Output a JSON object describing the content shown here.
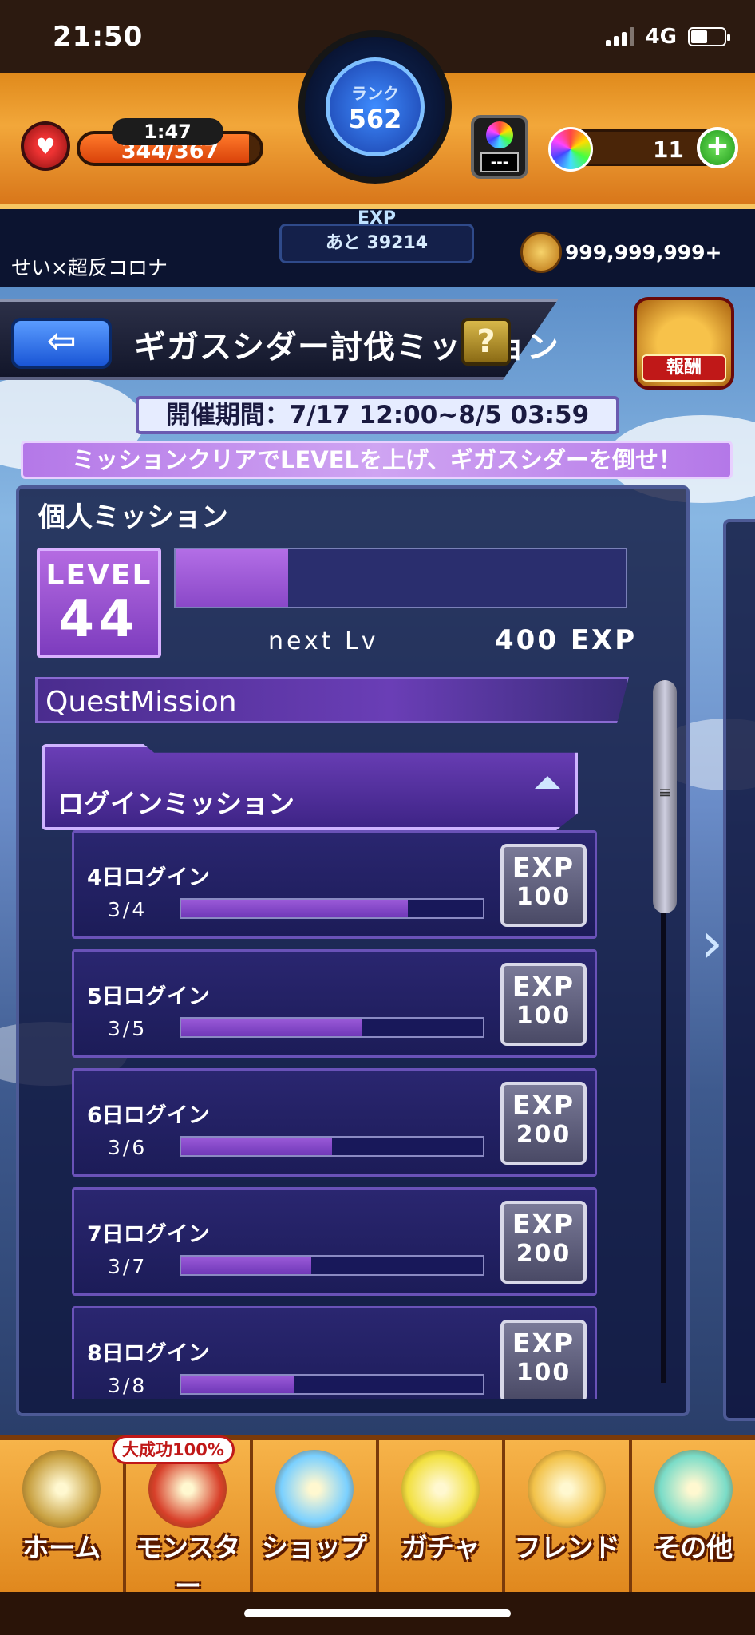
{
  "status_bar": {
    "time": "21:50",
    "network": "4G",
    "battery_icon": "battery-icon",
    "signal_icon": "signal-icon"
  },
  "hud": {
    "stamina_timer": "1:47",
    "stamina": "344/367",
    "stamina_fraction": 0.937,
    "rank_label": "ランク",
    "rank": "562",
    "exp_label": "EXP",
    "exp_remaining": "あと 39214",
    "orb_slot": "---",
    "orb_count": "11",
    "plus_label": "+",
    "username": "せい×超反コロナ",
    "coins": "999,999,999+"
  },
  "title_bar": {
    "back_label": "⇦",
    "title": "ギガスシダー討伐ミッション",
    "help_label": "?",
    "reward_label": "報酬"
  },
  "event": {
    "period": "開催期間：7/17 12:00~8/5 03:59",
    "banner": "ミッションクリアでLEVELを上げ、ギガスシダーを倒せ！"
  },
  "personal": {
    "section_title": "個人ミッション",
    "level_label": "LEVEL",
    "level": "44",
    "level_progress": 0.25,
    "next_label": "next Lv",
    "next_exp": "400",
    "next_exp_unit": "EXP"
  },
  "quest": {
    "header": "QuestMission",
    "group_label": "ログインミッション",
    "missions": [
      {
        "name": "4日ログイン",
        "progress": "3/4",
        "fraction": 0.75,
        "reward_label": "EXP",
        "reward": "100"
      },
      {
        "name": "5日ログイン",
        "progress": "3/5",
        "fraction": 0.6,
        "reward_label": "EXP",
        "reward": "100"
      },
      {
        "name": "6日ログイン",
        "progress": "3/6",
        "fraction": 0.5,
        "reward_label": "EXP",
        "reward": "200"
      },
      {
        "name": "7日ログイン",
        "progress": "3/7",
        "fraction": 0.43,
        "reward_label": "EXP",
        "reward": "200"
      },
      {
        "name": "8日ログイン",
        "progress": "3/8",
        "fraction": 0.375,
        "reward_label": "EXP",
        "reward": "100"
      }
    ]
  },
  "nav": {
    "badge": "大成功100%",
    "items": [
      {
        "label": "ホーム",
        "icon": "home-gate-icon",
        "color": "#c8a040"
      },
      {
        "label": "モンスター",
        "icon": "monster-icon",
        "color": "#d8402a"
      },
      {
        "label": "ショップ",
        "icon": "rainbow-orb-icon",
        "color": "#7ad0ff"
      },
      {
        "label": "ガチャ",
        "icon": "gacha-egg-icon",
        "color": "#f2e040"
      },
      {
        "label": "フレンド",
        "icon": "friend-balloon-icon",
        "color": "#f2c24a"
      },
      {
        "label": "その他",
        "icon": "other-menu-icon",
        "color": "#7adcc8"
      }
    ]
  }
}
